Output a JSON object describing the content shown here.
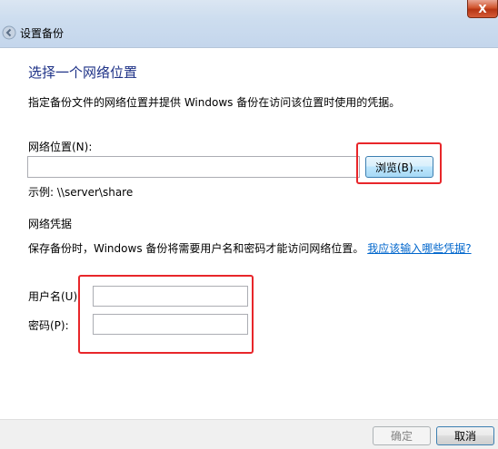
{
  "window": {
    "title": "设置备份",
    "close_glyph": "X"
  },
  "page": {
    "heading": "选择一个网络位置",
    "description": "指定备份文件的网络位置并提供 Windows 备份在访问该位置时使用的凭据。"
  },
  "network_location": {
    "label": "网络位置(N):",
    "value": "",
    "browse_label": "浏览(B)...",
    "example": "示例: \\\\server\\share"
  },
  "credentials": {
    "heading": "网络凭据",
    "description": "保存备份时，Windows 备份将需要用户名和密码才能访问网络位置。",
    "link": "我应该输入哪些凭据?",
    "username_label": "用户名(U):",
    "username_value": "",
    "password_label": "密码(P):",
    "password_value": ""
  },
  "footer": {
    "ok_label": "确定",
    "cancel_label": "取消"
  },
  "colors": {
    "heading": "#1e3287",
    "link": "#0066cc",
    "highlight": "#e8262a"
  },
  "icons": {
    "back": "back-arrow-icon",
    "close": "close-icon"
  }
}
